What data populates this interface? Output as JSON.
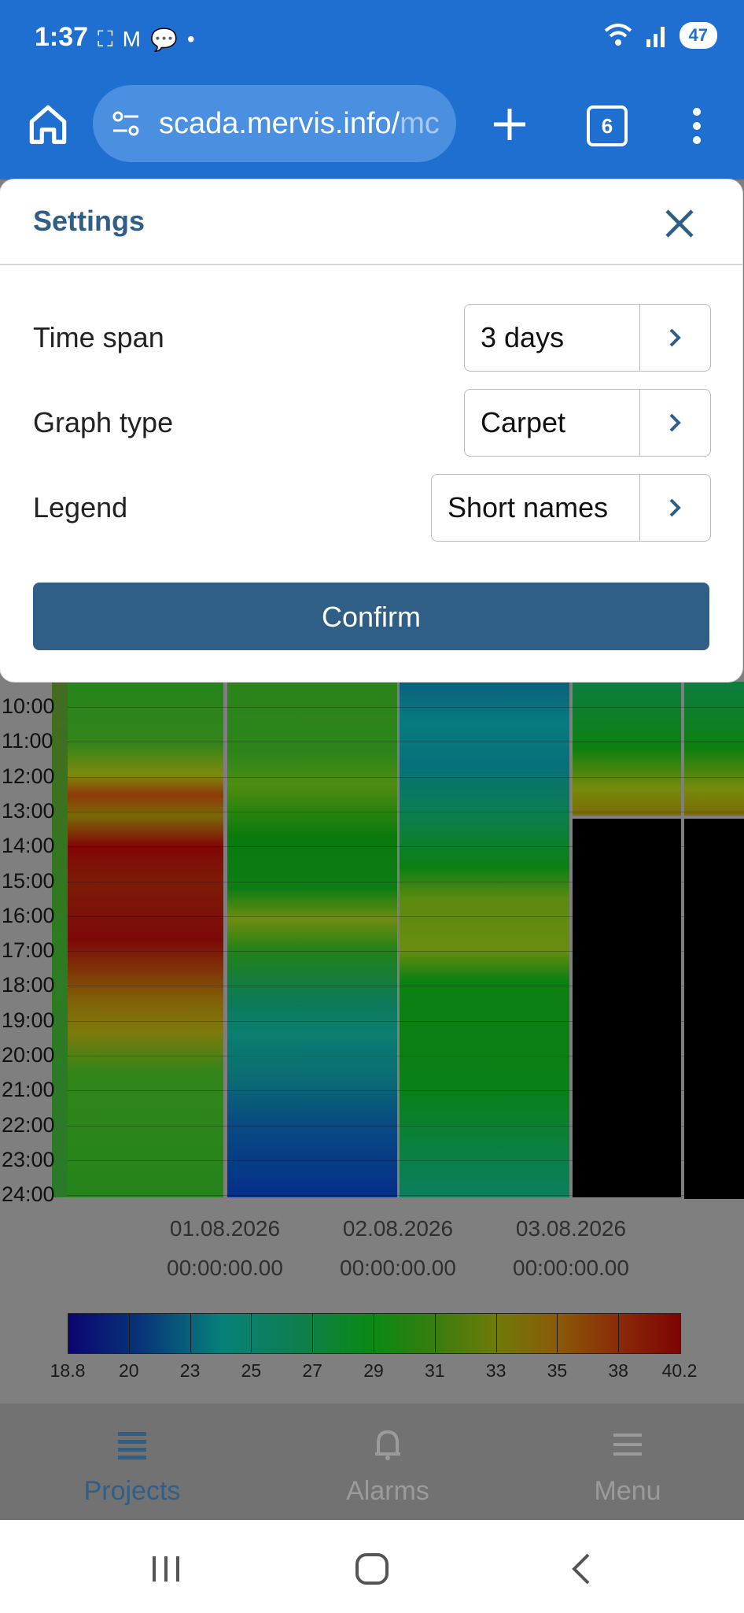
{
  "status_bar": {
    "time": "1:37",
    "battery": "47"
  },
  "browser": {
    "url": "scada.mervis.info/",
    "url_fade": "mc",
    "tab_count": "6"
  },
  "modal": {
    "title": "Settings",
    "rows": [
      {
        "label": "Time span",
        "value": "3 days"
      },
      {
        "label": "Graph type",
        "value": "Carpet"
      },
      {
        "label": "Legend",
        "value": "Short names"
      }
    ],
    "confirm_label": "Confirm"
  },
  "chart_data": {
    "type": "heatmap",
    "y_tick_labels": [
      "10:00",
      "11:00",
      "12:00",
      "13:00",
      "14:00",
      "15:00",
      "16:00",
      "17:00",
      "18:00",
      "19:00",
      "20:00",
      "21:00",
      "22:00",
      "23:00",
      "24:00"
    ],
    "x_labels": [
      {
        "date": "01.08.2026",
        "time": "00:00:00.00"
      },
      {
        "date": "02.08.2026",
        "time": "00:00:00.00"
      },
      {
        "date": "03.08.2026",
        "time": "00:00:00.00"
      }
    ],
    "color_scale": {
      "min": 18.8,
      "max": 40.2,
      "tick_labels": [
        "18.8",
        "20",
        "23",
        "25",
        "27",
        "29",
        "31",
        "33",
        "35",
        "38",
        "40.2"
      ],
      "colors": [
        "#0a0570",
        "#08357a",
        "#07807a",
        "#0a8a12",
        "#6f7a08",
        "#8a2a08",
        "#7e0404"
      ]
    }
  },
  "bottom_nav": {
    "items": [
      {
        "label": "Projects",
        "active": true
      },
      {
        "label": "Alarms",
        "active": false
      },
      {
        "label": "Menu",
        "active": false
      }
    ],
    "active_color": "#2f5f86",
    "inactive_color": "#9b9b9b"
  }
}
